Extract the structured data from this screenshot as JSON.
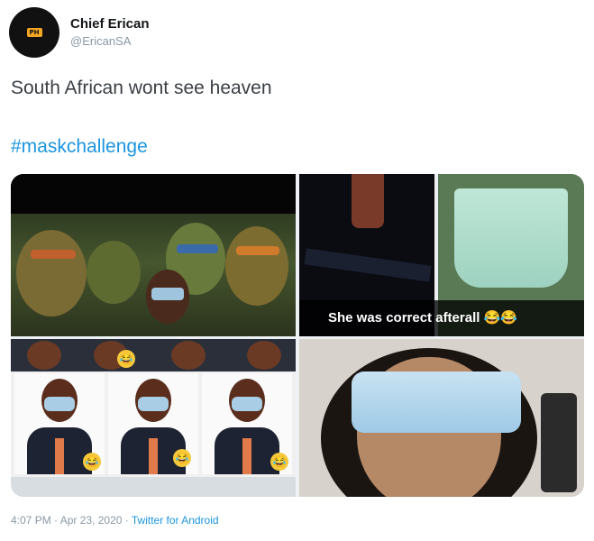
{
  "author": {
    "name": "Chief Erican",
    "handle": "@EricanSA"
  },
  "tweet": {
    "text": "South African wont see heaven",
    "hashtag": "#maskchallenge"
  },
  "media": {
    "caption": "She was correct afterall",
    "caption_emoji": "😂😂"
  },
  "footer": {
    "timestamp": "4:07 PM · Apr 23, 2020 · ",
    "source": "Twitter for Android"
  },
  "colors": {
    "link": "#1b95e0",
    "muted": "#8899a6",
    "text": "#14171a"
  },
  "icons": [
    "avatar-logo",
    "laughing-emoji-icon"
  ]
}
